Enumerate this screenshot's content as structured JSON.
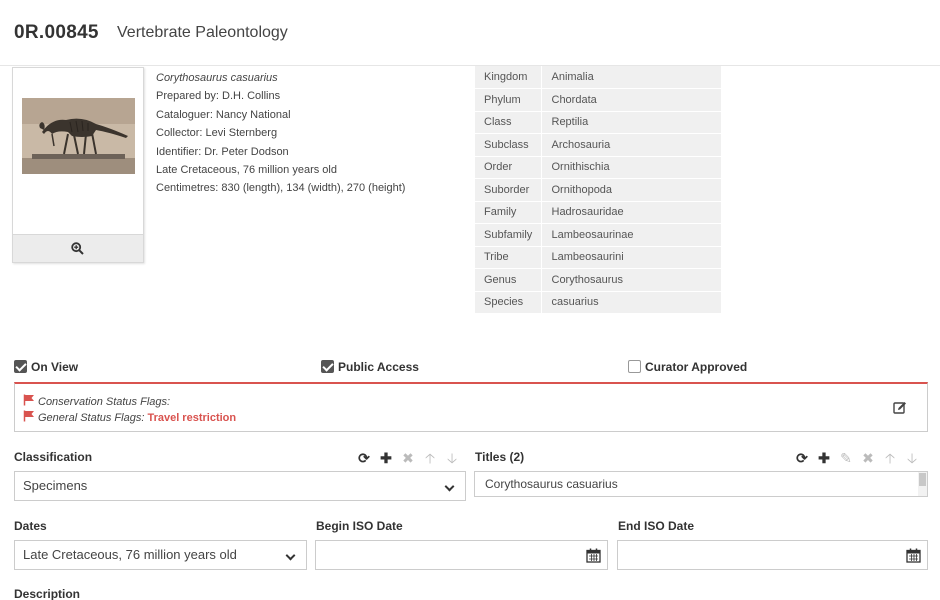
{
  "record": {
    "number": "0R.00845",
    "department": "Vertebrate Paleontology"
  },
  "object_info": {
    "scientific_name": "Corythosaurus casuarius",
    "prepared_by": "Prepared by: D.H. Collins",
    "cataloguer": "Cataloguer: Nancy National",
    "collector": "Collector: Levi Sternberg",
    "identifier": "Identifier: Dr. Peter Dodson",
    "age": "Late Cretaceous, 76 million years old",
    "dimensions": "Centimetres: 830 (length), 134 (width), 270 (height)"
  },
  "taxonomy": [
    {
      "rank": "Kingdom",
      "value": "Animalia"
    },
    {
      "rank": "Phylum",
      "value": "Chordata"
    },
    {
      "rank": "Class",
      "value": "Reptilia"
    },
    {
      "rank": "Subclass",
      "value": "Archosauria"
    },
    {
      "rank": "Order",
      "value": "Ornithischia"
    },
    {
      "rank": "Suborder",
      "value": "Ornithopoda"
    },
    {
      "rank": "Family",
      "value": "Hadrosauridae"
    },
    {
      "rank": "Subfamily",
      "value": "Lambeosaurinae"
    },
    {
      "rank": "Tribe",
      "value": "Lambeosaurini"
    },
    {
      "rank": "Genus",
      "value": "Corythosaurus"
    },
    {
      "rank": "Species",
      "value": "casuarius"
    }
  ],
  "checkboxes": {
    "on_view": {
      "label": "On View",
      "checked": true
    },
    "public_access": {
      "label": "Public Access",
      "checked": true
    },
    "curator_approved": {
      "label": "Curator Approved",
      "checked": false
    }
  },
  "flags": {
    "conservation_label": "Conservation Status Flags:",
    "general_label": "General Status Flags:",
    "general_value": "Travel restriction",
    "flag_color": "#d9534f"
  },
  "classification": {
    "label": "Classification",
    "value": "Specimens"
  },
  "titles": {
    "label": "Titles",
    "count": "(2)",
    "value": "Corythosaurus casuarius"
  },
  "dates": {
    "label": "Dates",
    "value": "Late Cretaceous, 76 million years old",
    "begin_label": "Begin ISO Date",
    "begin_value": "",
    "end_label": "End ISO Date",
    "end_value": ""
  },
  "description": {
    "label": "Description"
  },
  "icons": {
    "refresh": "refresh-icon",
    "add": "plus-icon",
    "remove": "close-icon",
    "move_up": "arrow-up-icon",
    "move_down": "arrow-down-icon",
    "edit": "edit-icon",
    "zoom": "zoom-in-icon",
    "calendar": "calendar-icon",
    "flag": "flag-icon"
  }
}
